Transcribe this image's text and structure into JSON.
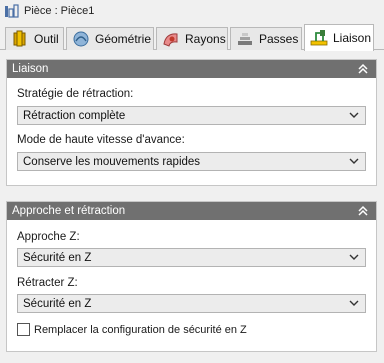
{
  "window": {
    "title": "Pièce : Pièce1"
  },
  "tabs": [
    {
      "label": "Outil",
      "icon": "tool-icon"
    },
    {
      "label": "Géométrie",
      "icon": "geometry-icon"
    },
    {
      "label": "Rayons",
      "icon": "radii-icon"
    },
    {
      "label": "Passes",
      "icon": "passes-icon"
    },
    {
      "label": "Liaison",
      "icon": "linking-icon",
      "active": true
    }
  ],
  "liaison": {
    "header": "Liaison",
    "retract_label": "Stratégie de rétraction:",
    "retract_value": "Rétraction complète",
    "feed_label": "Mode de haute vitesse d'avance:",
    "feed_value": "Conserve les mouvements rapides"
  },
  "approach": {
    "header": "Approche et rétraction",
    "approachz_label": "Approche Z:",
    "approachz_value": "Sécurité en Z",
    "retractz_label": "Rétracter Z:",
    "retractz_value": "Sécurité en Z",
    "override_label": "Remplacer la configuration de sécurité en Z",
    "override_checked": false
  },
  "colors": {
    "panel_header": "#707070",
    "accent": "#f2c200"
  }
}
